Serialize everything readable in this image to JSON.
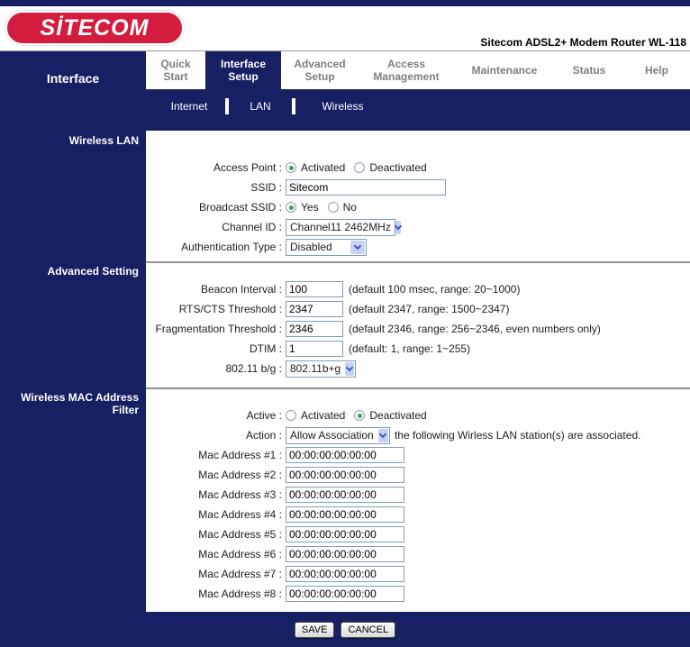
{
  "header": {
    "logo_text": "SİTECOM",
    "product_title": "Sitecom ADSL2+ Modem Router WL-118"
  },
  "nav": {
    "section_label": "Interface",
    "tabs": [
      {
        "label1": "Quick",
        "label2": "Start",
        "active": false
      },
      {
        "label1": "Interface",
        "label2": "Setup",
        "active": true
      },
      {
        "label1": "Advanced",
        "label2": "Setup",
        "active": false
      },
      {
        "label1": "Access",
        "label2": "Management",
        "active": false
      },
      {
        "label1": "Maintenance",
        "label2": "",
        "active": false
      },
      {
        "label1": "Status",
        "label2": "",
        "active": false
      },
      {
        "label1": "Help",
        "label2": "",
        "active": false
      }
    ],
    "subtabs": [
      {
        "label": "Internet"
      },
      {
        "label": "LAN"
      },
      {
        "label": "Wireless"
      }
    ]
  },
  "wireless_lan": {
    "title": "Wireless LAN",
    "access_point": {
      "label": "Access Point :",
      "option1": "Activated",
      "option2": "Deactivated",
      "selected": "Activated"
    },
    "ssid": {
      "label": "SSID :",
      "value": "Sitecom"
    },
    "broadcast_ssid": {
      "label": "Broadcast SSID :",
      "option1": "Yes",
      "option2": "No",
      "selected": "Yes"
    },
    "channel_id": {
      "label": "Channel ID :",
      "value": "Channel11 2462MHz"
    },
    "auth_type": {
      "label": "Authentication Type :",
      "value": "Disabled"
    }
  },
  "advanced": {
    "title": "Advanced Setting",
    "rows": [
      {
        "label": "Beacon Interval :",
        "value": "100",
        "hint": "(default 100 msec, range: 20~1000)"
      },
      {
        "label": "RTS/CTS Threshold :",
        "value": "2347",
        "hint": "(default 2347, range: 1500~2347)"
      },
      {
        "label": "Fragmentation Threshold :",
        "value": "2346",
        "hint": "(default 2346, range: 256~2346, even numbers only)"
      },
      {
        "label": "DTIM :",
        "value": "1",
        "hint": "(default: 1, range: 1~255)"
      }
    ],
    "mode": {
      "label": "802.11 b/g :",
      "value": "802.11b+g"
    }
  },
  "mac_filter": {
    "title_line1": "Wireless MAC Address",
    "title_line2": "Filter",
    "active": {
      "label": "Active :",
      "option1": "Activated",
      "option2": "Deactivated",
      "selected": "Deactivated"
    },
    "action": {
      "label": "Action :",
      "value": "Allow Association",
      "suffix": "the following Wirless LAN station(s) are associated."
    },
    "mac_rows": [
      {
        "label": "Mac Address #1 :",
        "value": "00:00:00:00:00:00"
      },
      {
        "label": "Mac Address #2 :",
        "value": "00:00:00:00:00:00"
      },
      {
        "label": "Mac Address #3 :",
        "value": "00:00:00:00:00:00"
      },
      {
        "label": "Mac Address #4 :",
        "value": "00:00:00:00:00:00"
      },
      {
        "label": "Mac Address #5 :",
        "value": "00:00:00:00:00:00"
      },
      {
        "label": "Mac Address #6 :",
        "value": "00:00:00:00:00:00"
      },
      {
        "label": "Mac Address #7 :",
        "value": "00:00:00:00:00:00"
      },
      {
        "label": "Mac Address #8 :",
        "value": "00:00:00:00:00:00"
      }
    ]
  },
  "footer": {
    "save_label": "SAVE",
    "cancel_label": "CANCEL"
  },
  "colors": {
    "navy": "#162063",
    "brand_red": "#d31c3e",
    "radio_green": "#3fa33f",
    "input_border": "#7f9db9"
  }
}
